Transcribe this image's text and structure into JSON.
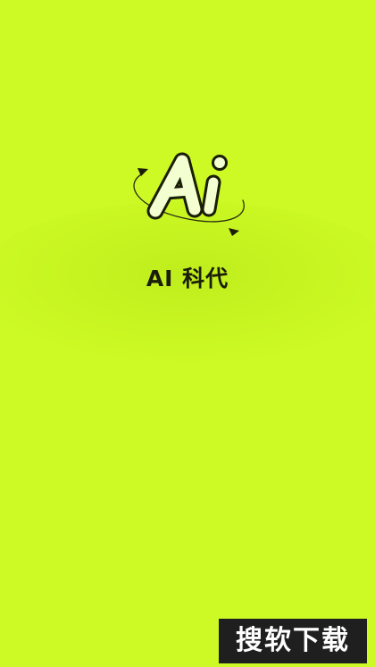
{
  "splash": {
    "background_color": "#cdfa25",
    "logo_icon": "ai-orbit-logo-icon",
    "app_name": "AI 科代"
  },
  "watermark": {
    "text": "搜软下载"
  }
}
